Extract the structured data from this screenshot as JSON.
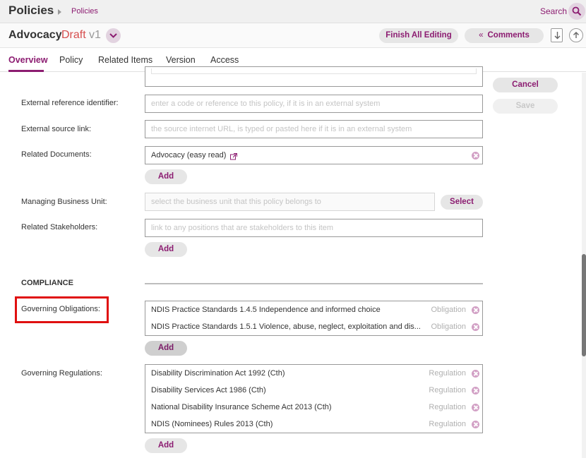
{
  "header": {
    "app_title": "Policies",
    "breadcrumb": "Policies",
    "search_label": "Search"
  },
  "document": {
    "title": "Advocacy",
    "status": "Draft",
    "version": "v1",
    "finish_label": "Finish All Editing",
    "comments_label": "Comments",
    "comments_chevron": "«"
  },
  "tabs": [
    {
      "label": "Overview"
    },
    {
      "label": "Policy"
    },
    {
      "label": "Related Items"
    },
    {
      "label": "Version"
    },
    {
      "label": "Access"
    }
  ],
  "actions": {
    "cancel_label": "Cancel",
    "save_label": "Save"
  },
  "form": {
    "external_reference": {
      "label": "External reference identifier:",
      "placeholder": "enter a code or reference to this policy, if it is in an external system"
    },
    "external_source": {
      "label": "External source link:",
      "placeholder": "the source internet URL, is typed or pasted here if it is in an external system"
    },
    "related_documents": {
      "label": "Related Documents:",
      "items": [
        "Advocacy (easy read)"
      ],
      "add_label": "Add"
    },
    "managing_unit": {
      "label": "Managing Business Unit:",
      "placeholder": "select the business unit that this policy belongs to",
      "select_label": "Select"
    },
    "related_stakeholders": {
      "label": "Related Stakeholders:",
      "placeholder": "link to any positions that are stakeholders to this item",
      "add_label": "Add"
    }
  },
  "compliance": {
    "section_title": "COMPLIANCE",
    "obligations": {
      "label": "Governing Obligations:",
      "items": [
        {
          "text": "NDIS Practice Standards 1.4.5 Independence and informed choice",
          "kind": "Obligation"
        },
        {
          "text": "NDIS Practice Standards 1.5.1 Violence, abuse, neglect, exploitation and dis...",
          "kind": "Obligation"
        }
      ],
      "add_label": "Add"
    },
    "regulations": {
      "label": "Governing Regulations:",
      "items": [
        {
          "text": "Disability Discrimination Act 1992 (Cth)",
          "kind": "Regulation"
        },
        {
          "text": "Disability Services Act 1986 (Cth)",
          "kind": "Regulation"
        },
        {
          "text": "National Disability Insurance Scheme Act 2013 (Cth)",
          "kind": "Regulation"
        },
        {
          "text": "NDIS (Nominees) Rules 2013 (Cth)",
          "kind": "Regulation"
        }
      ],
      "add_label": "Add"
    }
  },
  "colors": {
    "accent": "#8c1c71",
    "status_draft": "#d64e4e",
    "highlight": "#e01010"
  }
}
